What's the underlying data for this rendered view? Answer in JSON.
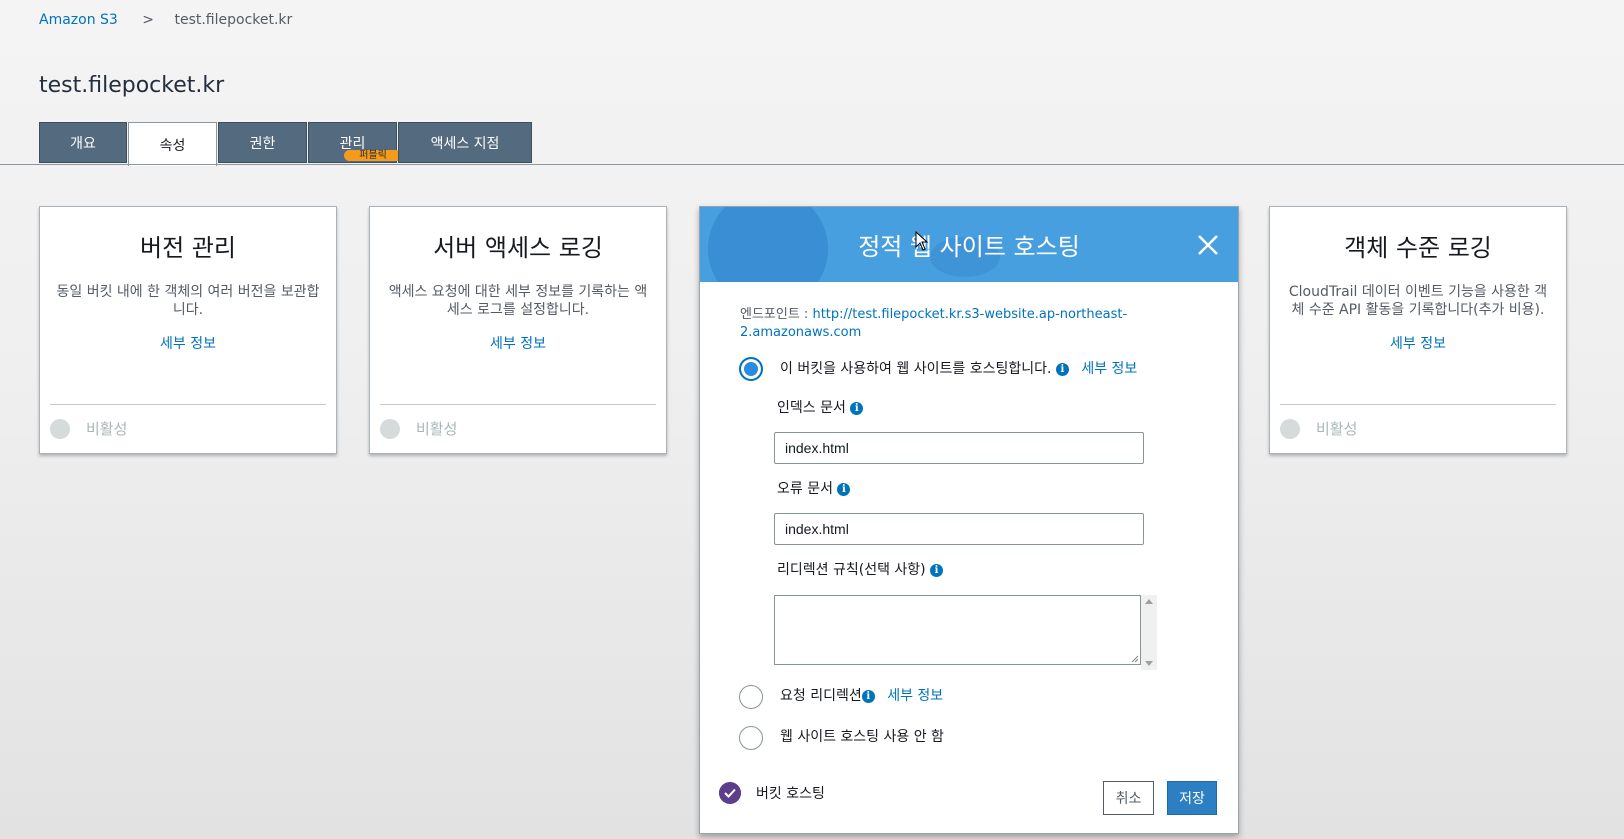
{
  "breadcrumb": {
    "root": "Amazon S3",
    "separator": ">",
    "current": "test.filepocket.kr"
  },
  "page_title": "test.filepocket.kr",
  "tabs": [
    {
      "label": "개요"
    },
    {
      "label": "속성",
      "active": true
    },
    {
      "label": "권한"
    },
    {
      "label": "관리",
      "badge": "퍼블릭"
    },
    {
      "label": "액세스 지점"
    }
  ],
  "cards": [
    {
      "title": "버전 관리",
      "desc": "동일 버킷 내에 한 객체의 여러 버전을 보관합니다.",
      "link": "세부 정보",
      "status": "비활성"
    },
    {
      "title": "서버 액세스 로깅",
      "desc": "액세스 요청에 대한 세부 정보를 기록하는 액세스 로그를 설정합니다.",
      "link": "세부 정보",
      "status": "비활성"
    },
    {
      "title": "객체 수준 로깅",
      "desc": "CloudTrail 데이터 이벤트 기능을 사용한 객체 수준 API 활동을 기록합니다(추가 비용).",
      "link": "세부 정보",
      "status": "비활성"
    }
  ],
  "modal": {
    "title": "정적 웹 사이트 호스팅",
    "endpoint_label": "엔드포인트 : ",
    "endpoint_url": "http://test.filepocket.kr.s3-website.ap-northeast-2.amazonaws.com",
    "option_host": "이 버킷을 사용하여 웹 사이트를 호스팅합니다.",
    "option_host_link": "세부 정보",
    "index_label": "인덱스 문서",
    "index_value": "index.html",
    "error_label": "오류 문서",
    "error_value": "index.html",
    "redirect_rules_label": "리디렉션 규칙(선택 사항)",
    "option_redirect": "요청 리디렉션",
    "option_redirect_link": "세부 정보",
    "option_disable": "웹 사이트 호스팅 사용 안 함",
    "bucket_hosting": "버킷 호스팅",
    "cancel": "취소",
    "save": "저장"
  },
  "colors": {
    "accent": "#479fe0",
    "tab_bg": "#546b7f",
    "link": "#0073bb",
    "badge": "#f49b1e",
    "check": "#5d3e8a"
  },
  "icons": [
    "chevron-right-icon",
    "close-icon",
    "info-icon",
    "check-icon",
    "mouse-cursor-icon"
  ]
}
